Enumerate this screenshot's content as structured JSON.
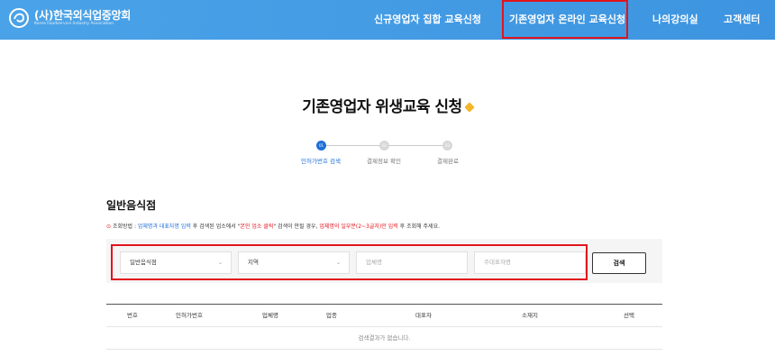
{
  "header": {
    "logo_title": "(사)한국외식업중앙회",
    "logo_subtitle": "Korea Foodservice Industry Association",
    "nav": [
      {
        "label": "신규영업자 집합 교육신청"
      },
      {
        "label": "기존영업자 온라인 교육신청"
      },
      {
        "label": "나의강의실"
      },
      {
        "label": "고객센터"
      }
    ],
    "highlight_color": "#e2141c",
    "bg_color": "#4aa3e8"
  },
  "page": {
    "title": "기존영업자 위생교육 신청"
  },
  "steps": [
    {
      "num": "01",
      "label": "인허가번호 검색",
      "active": true
    },
    {
      "num": "02",
      "label": "결제정보 확인",
      "active": false
    },
    {
      "num": "03",
      "label": "결제완료",
      "active": false
    }
  ],
  "section": {
    "title": "일반음식점",
    "guide_prefix": "조회방법 : ",
    "guide_blue": "업체명과 대표자명 입력",
    "guide_mid1": " 후 검색된 업소에서 \"",
    "guide_red1": "본인 업소 클릭",
    "guide_mid2": "\" 검색이 안될 경우, ",
    "guide_red2": "업체명의 일부분(2~3글자)만 입력",
    "guide_suffix": " 후 조회해 주세요."
  },
  "search": {
    "category_value": "일반음식점",
    "region_value": "지역",
    "business_placeholder": "업체명",
    "owner_placeholder": "주대표자명",
    "button_label": "검색"
  },
  "table": {
    "columns": [
      "번호",
      "인허가번호",
      "업체명",
      "업종",
      "대표자",
      "소재지",
      "선택"
    ],
    "empty_message": "검색결과가 없습니다."
  }
}
